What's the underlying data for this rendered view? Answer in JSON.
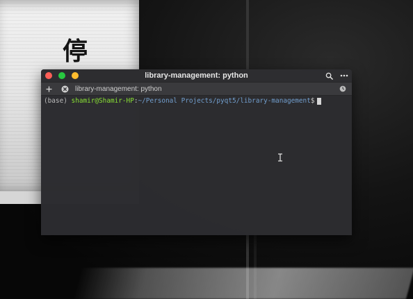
{
  "window": {
    "title": "library-management: python"
  },
  "tabs": [
    {
      "label": "library-management: python"
    }
  ],
  "terminal": {
    "env": "(base)",
    "user_host": "shamir@Shamir-HP",
    "separator": ":",
    "path": "~/Personal Projects/pyqt5/library-management",
    "prompt_symbol": "$"
  },
  "icons": {
    "close": "close-window-icon",
    "minimize": "minimize-window-icon",
    "maximize": "maximize-window-icon",
    "search": "search-icon",
    "menu": "more-options-icon",
    "add_tab": "plus-icon",
    "tab_close": "tab-close-icon",
    "history": "history-clock-icon",
    "text_cursor": "ibeam-cursor-icon"
  },
  "colors": {
    "close": "#ff5f57",
    "minimize": "#28c840",
    "maximize": "#febc2e",
    "prompt_user": "#8ae234",
    "prompt_path": "#729fcf"
  }
}
